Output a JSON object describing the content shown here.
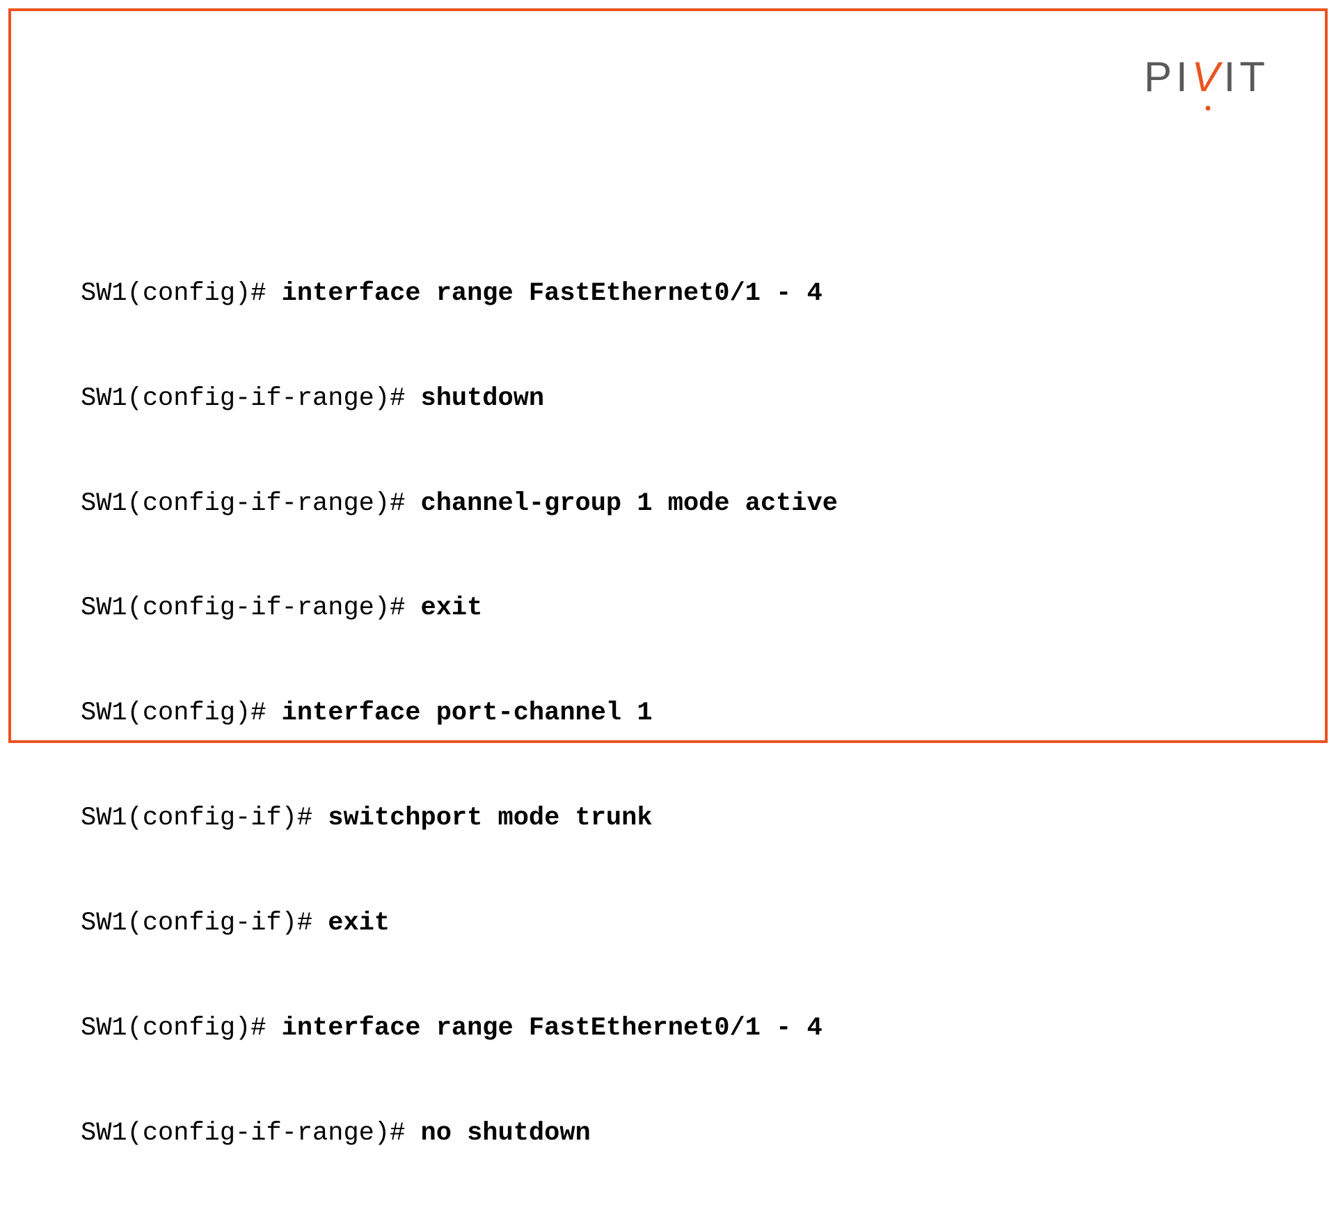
{
  "logo": {
    "part1": "PI",
    "partV": "V",
    "part2": "IT"
  },
  "lines": [
    {
      "prompt": "SW1(config)# ",
      "command": "interface range FastEthernet0/1 - 4"
    },
    {
      "prompt": "SW1(config-if-range)# ",
      "command": "shutdown"
    },
    {
      "prompt": "SW1(config-if-range)# ",
      "command": "channel-group 1 mode active"
    },
    {
      "prompt": "SW1(config-if-range)# ",
      "command": "exit"
    },
    {
      "prompt": "SW1(config)# ",
      "command": "interface port-channel 1"
    },
    {
      "prompt": "SW1(config-if)# ",
      "command": "switchport mode trunk"
    },
    {
      "prompt": "SW1(config-if)# ",
      "command": "exit"
    },
    {
      "prompt": "SW1(config)# ",
      "command": "interface range FastEthernet0/1 - 4"
    },
    {
      "prompt": "SW1(config-if-range)# ",
      "command": "no shutdown"
    }
  ]
}
